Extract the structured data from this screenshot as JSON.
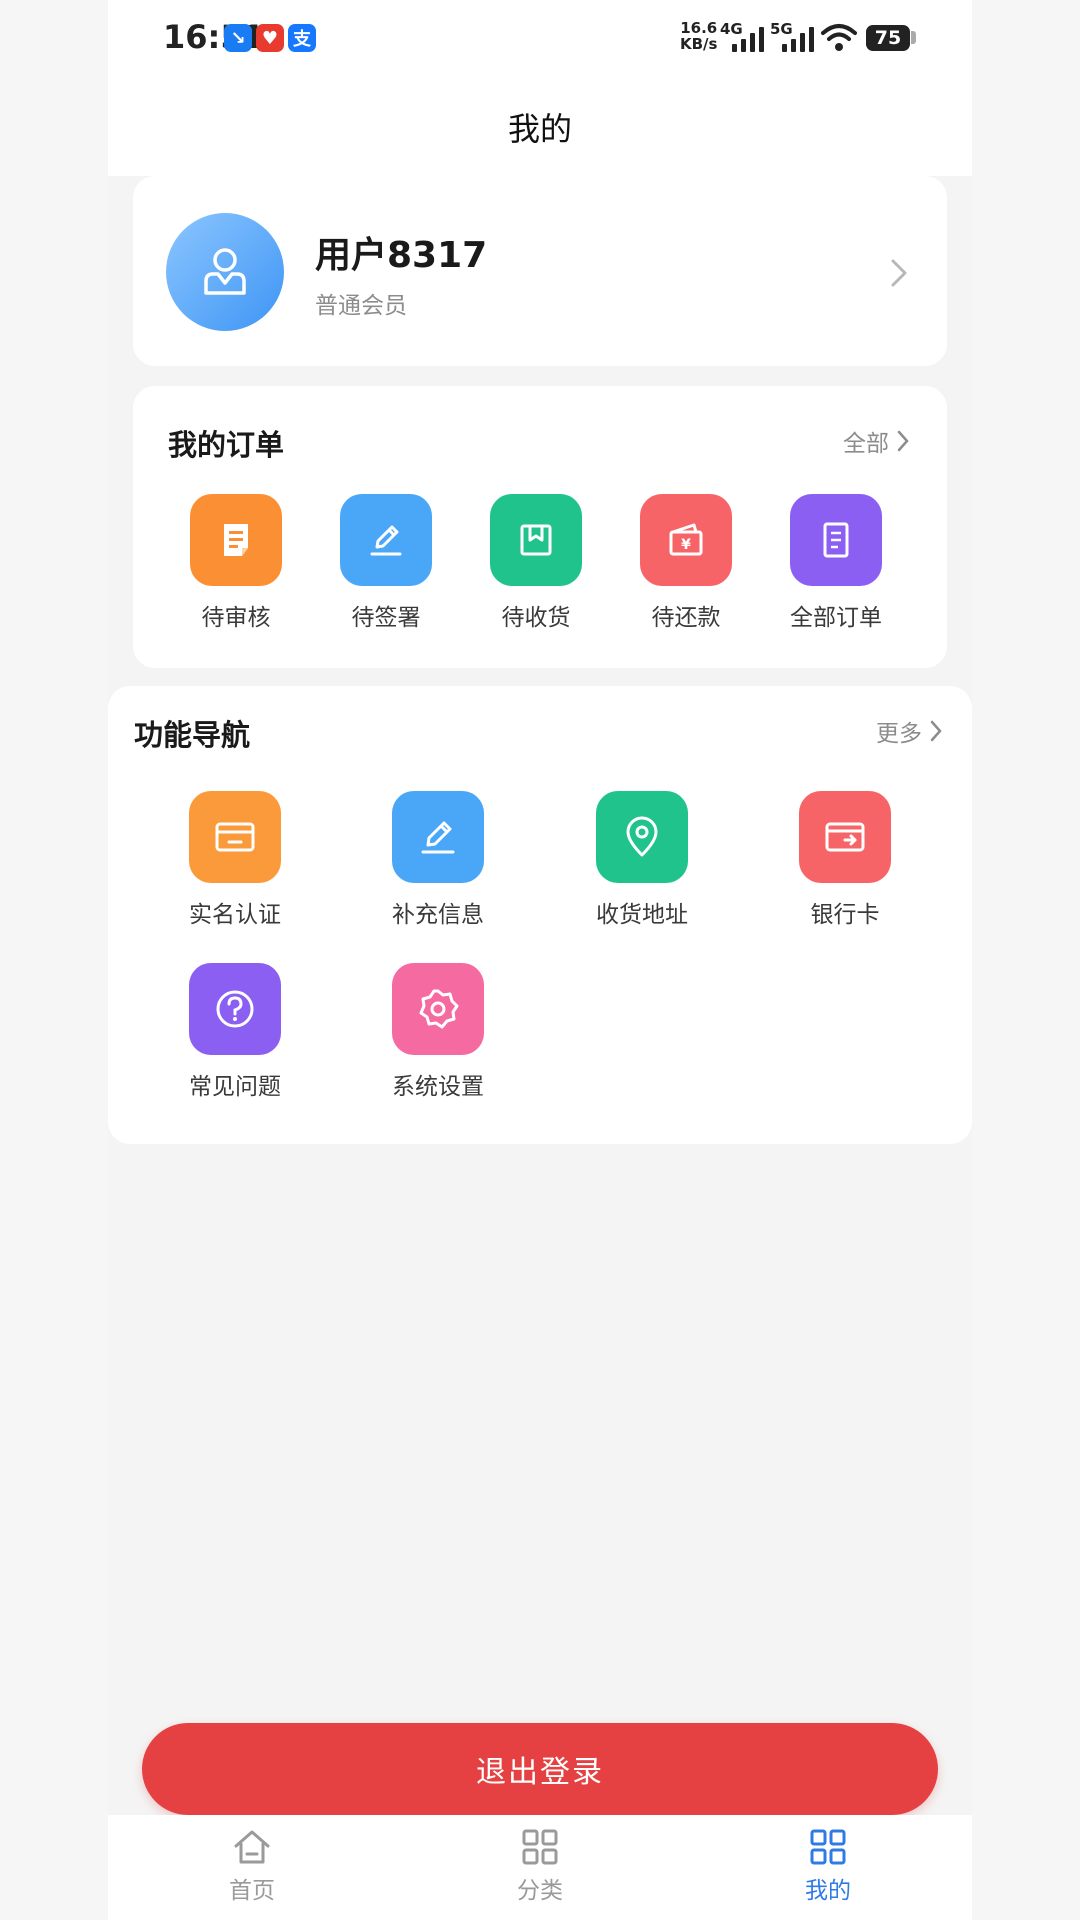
{
  "status_bar": {
    "time": "16:51",
    "apps": [
      {
        "glyph": "↘",
        "color": "#1a7cf3"
      },
      {
        "glyph": "♥",
        "color": "#e83a2e"
      },
      {
        "glyph": "支",
        "color": "#1677ff"
      }
    ],
    "net_rate_value": "16.6",
    "net_rate_unit": "KB/s",
    "net_4g": "4G",
    "net_5g": "5G",
    "battery": "75"
  },
  "header": {
    "title": "我的"
  },
  "profile": {
    "name": "用户8317",
    "level": "普通会员"
  },
  "orders": {
    "title": "我的订单",
    "more_label": "全部",
    "items": [
      {
        "label": "待审核",
        "icon": "document-icon",
        "color": "#fb8f33"
      },
      {
        "label": "待签署",
        "icon": "edit-icon",
        "color": "#4aa7f7"
      },
      {
        "label": "待收货",
        "icon": "package-icon",
        "color": "#21c38d"
      },
      {
        "label": "待还款",
        "icon": "wallet-icon",
        "color": "#f76467"
      },
      {
        "label": "全部订单",
        "icon": "list-icon",
        "color": "#8a5ff1"
      }
    ]
  },
  "features": {
    "title": "功能导航",
    "more_label": "更多",
    "items": [
      {
        "label": "实名认证",
        "icon": "id-card-icon",
        "color": "#fb9a3a"
      },
      {
        "label": "补充信息",
        "icon": "edit-icon",
        "color": "#4aa7f7"
      },
      {
        "label": "收货地址",
        "icon": "location-icon",
        "color": "#21c38d"
      },
      {
        "label": "银行卡",
        "icon": "bank-card-icon",
        "color": "#f76467"
      },
      {
        "label": "常见问题",
        "icon": "question-icon",
        "color": "#8a5ff1"
      },
      {
        "label": "系统设置",
        "icon": "settings-icon",
        "color": "#f56aa0"
      }
    ]
  },
  "logout_label": "退出登录",
  "tabs": [
    {
      "label": "首页",
      "icon": "home-icon",
      "active": false
    },
    {
      "label": "分类",
      "icon": "grid-icon",
      "active": false
    },
    {
      "label": "我的",
      "icon": "grid-icon",
      "active": true
    }
  ],
  "colors": {
    "accent": "#2f7be6",
    "logout": "#e64142"
  }
}
